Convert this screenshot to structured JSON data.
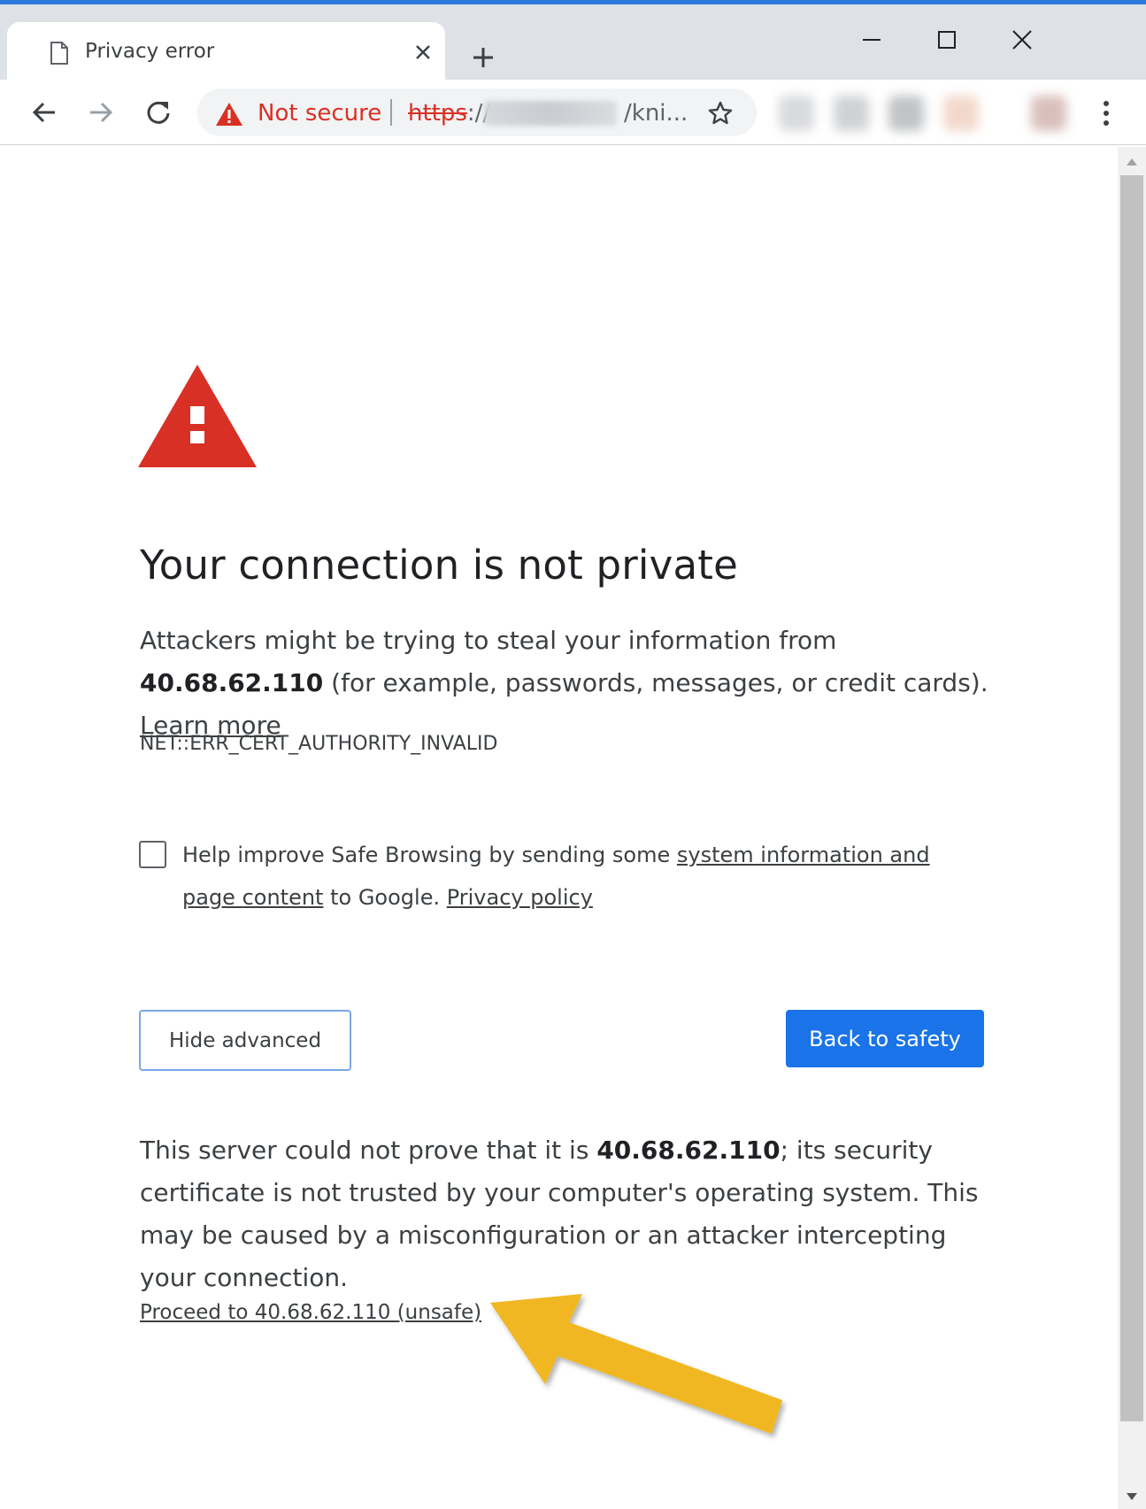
{
  "colors": {
    "accent": "#1a73e8",
    "danger": "#d93025",
    "annotation_arrow": "#f0b723"
  },
  "tab": {
    "title": "Privacy error",
    "icon": "document-icon",
    "close_icon": "close-icon"
  },
  "window_controls": {
    "minimize_icon": "minimize-icon",
    "maximize_icon": "maximize-icon",
    "close_icon": "close-icon"
  },
  "toolbar": {
    "back_icon": "arrow-left-icon",
    "forward_icon": "arrow-right-icon",
    "reload_icon": "reload-icon",
    "security_label": "Not secure",
    "url_scheme": "https",
    "url_separator": "://",
    "url_path": "/kni...",
    "bookmark_icon": "star-icon",
    "menu_icon": "more-vert-icon"
  },
  "page": {
    "heading": "Your connection is not private",
    "intro_before": "Attackers might be trying to steal your information from ",
    "host": "40.68.62.110",
    "intro_after": " (for example, passwords, messages, or credit cards). ",
    "learn_more": "Learn more",
    "error_code": "NET::ERR_CERT_AUTHORITY_INVALID",
    "safe_browsing_before": "Help improve Safe Browsing by sending some ",
    "safe_browsing_link": "system information and page content",
    "safe_browsing_after": " to Google. ",
    "privacy_policy": "Privacy policy",
    "hide_advanced": "Hide advanced",
    "back_to_safety": "Back to safety",
    "details_before": "This server could not prove that it is ",
    "details_host": "40.68.62.110",
    "details_after": "; its security certificate is not trusted by your computer's operating system. This may be caused by a misconfiguration or an attacker intercepting your connection.",
    "proceed_link": "Proceed to 40.68.62.110 (unsafe)"
  }
}
